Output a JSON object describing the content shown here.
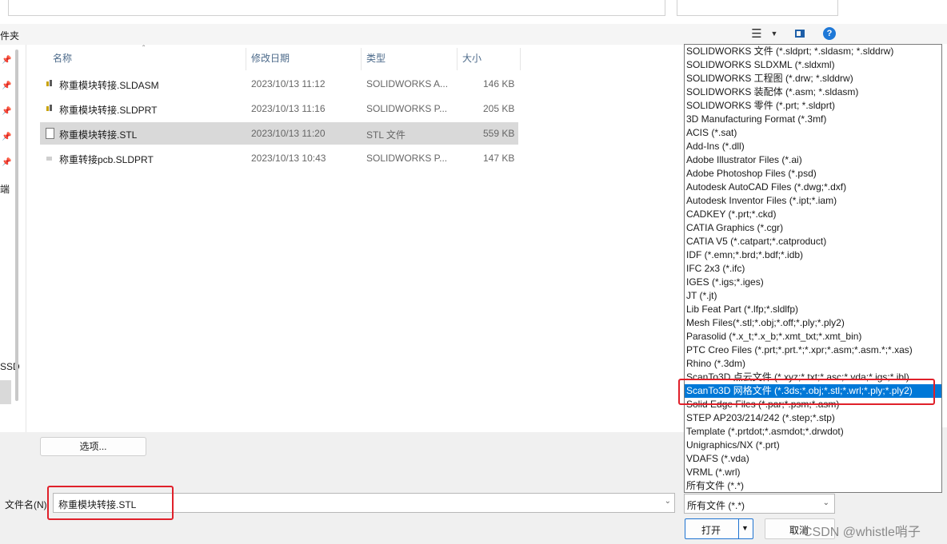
{
  "toolbar": {
    "folder_label": "件夹"
  },
  "columns": {
    "name": "名称",
    "modified": "修改日期",
    "type": "类型",
    "size": "大小"
  },
  "files": [
    {
      "name": "称重模块转接.SLDASM",
      "modified": "2023/10/13 11:12",
      "type": "SOLIDWORKS A...",
      "size": "146 KB",
      "icon": "solidworks-assembly-icon",
      "selected": false
    },
    {
      "name": "称重模块转接.SLDPRT",
      "modified": "2023/10/13 11:16",
      "type": "SOLIDWORKS P...",
      "size": "205 KB",
      "icon": "solidworks-part-icon",
      "selected": false
    },
    {
      "name": "称重模块转接.STL",
      "modified": "2023/10/13 11:20",
      "type": "STL 文件",
      "size": "559 KB",
      "icon": "file-icon",
      "selected": true
    },
    {
      "name": "称重转接pcb.SLDPRT",
      "modified": "2023/10/13 10:43",
      "type": "SOLIDWORKS P...",
      "size": "147 KB",
      "icon": "solidworks-part-icon",
      "selected": false
    }
  ],
  "nav_fragments": {
    "item1": "端",
    "item2": "SSD"
  },
  "buttons": {
    "options": "选项...",
    "open": "打开",
    "cancel": "取消"
  },
  "filename": {
    "label": "文件名(N):",
    "value": "称重模块转接.STL"
  },
  "filter": {
    "selected": "所有文件 (*.*)"
  },
  "file_types": [
    "SOLIDWORKS 文件 (*.sldprt; *.sldasm; *.slddrw)",
    "SOLIDWORKS SLDXML (*.sldxml)",
    "SOLIDWORKS 工程图 (*.drw; *.slddrw)",
    "SOLIDWORKS 装配体 (*.asm; *.sldasm)",
    "SOLIDWORKS 零件 (*.prt; *.sldprt)",
    "3D Manufacturing Format (*.3mf)",
    "ACIS (*.sat)",
    "Add-Ins (*.dll)",
    "Adobe Illustrator Files (*.ai)",
    "Adobe Photoshop Files (*.psd)",
    "Autodesk AutoCAD Files (*.dwg;*.dxf)",
    "Autodesk Inventor Files (*.ipt;*.iam)",
    "CADKEY (*.prt;*.ckd)",
    "CATIA Graphics (*.cgr)",
    "CATIA V5 (*.catpart;*.catproduct)",
    "IDF (*.emn;*.brd;*.bdf;*.idb)",
    "IFC 2x3 (*.ifc)",
    "IGES (*.igs;*.iges)",
    "JT (*.jt)",
    "Lib Feat Part (*.lfp;*.sldlfp)",
    "Mesh Files(*.stl;*.obj;*.off;*.ply;*.ply2)",
    "Parasolid (*.x_t;*.x_b;*.xmt_txt;*.xmt_bin)",
    "PTC Creo Files (*.prt;*.prt.*;*.xpr;*.asm;*.asm.*;*.xas)",
    "Rhino (*.3dm)",
    "ScanTo3D 点云文件 (*.xyz;*.txt;*.asc;*.vda;*.igs;*.ibl)",
    "ScanTo3D 网格文件 (*.3ds;*.obj;*.stl;*.wrl;*.ply;*.ply2)",
    "Solid Edge Files (*.par;*.psm;*.asm)",
    "STEP AP203/214/242 (*.step;*.stp)",
    "Template (*.prtdot;*.asmdot;*.drwdot)",
    "Unigraphics/NX (*.prt)",
    "VDAFS (*.vda)",
    "VRML (*.wrl)",
    "所有文件 (*.*)"
  ],
  "highlighted_type_index": 25,
  "colors": {
    "accent": "#0078d7",
    "annotation": "#e0202a"
  },
  "watermark": "CSDN @whistle哨子"
}
